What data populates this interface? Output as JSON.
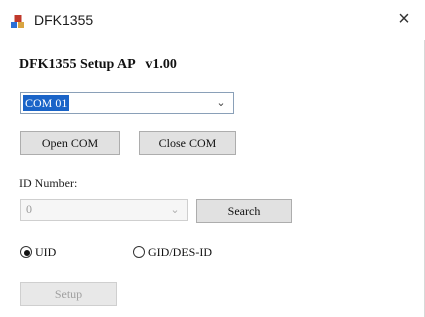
{
  "window": {
    "title": "DFK1355",
    "close_symbol": "×",
    "icon": "app-logo-icon"
  },
  "heading": "DFK1355 Setup AP   v1.00",
  "com_port": {
    "selected": "COM 01",
    "arrow": "⌄"
  },
  "buttons": {
    "open_com": "Open COM",
    "close_com": "Close COM",
    "search": "Search",
    "setup": "Setup"
  },
  "id_number": {
    "label": "ID Number:",
    "value": "0",
    "arrow": "⌄"
  },
  "mode": {
    "options": [
      "UID",
      "GID/DES-ID"
    ],
    "selected": "UID"
  },
  "colors": {
    "selection": "#1a64c8",
    "disabled_text": "#a0a0a0"
  }
}
